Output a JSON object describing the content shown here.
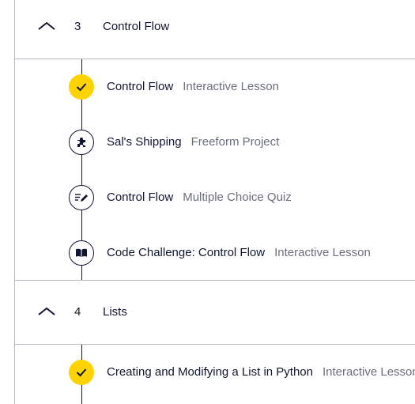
{
  "modules": [
    {
      "number": "3",
      "title": "Control Flow",
      "items": [
        {
          "title": "Control Flow",
          "type": "Interactive Lesson",
          "icon": "check-icon",
          "completed": true
        },
        {
          "title": "Sal's Shipping",
          "type": "Freeform Project",
          "icon": "puzzle-icon",
          "completed": false
        },
        {
          "title": "Control Flow",
          "type": "Multiple Choice Quiz",
          "icon": "quiz-icon",
          "completed": false
        },
        {
          "title": "Code Challenge: Control Flow",
          "type": "Interactive Lesson",
          "icon": "book-icon",
          "completed": false
        }
      ]
    },
    {
      "number": "4",
      "title": "Lists",
      "items": [
        {
          "title": "Creating and Modifying a List in Python",
          "type": "Interactive Lesson",
          "icon": "check-icon",
          "completed": true
        }
      ]
    }
  ],
  "colors": {
    "completed": "#ffd300",
    "text": "#10162f",
    "secondary_text": "#6b6e7e",
    "divider": "#b9bac1"
  }
}
